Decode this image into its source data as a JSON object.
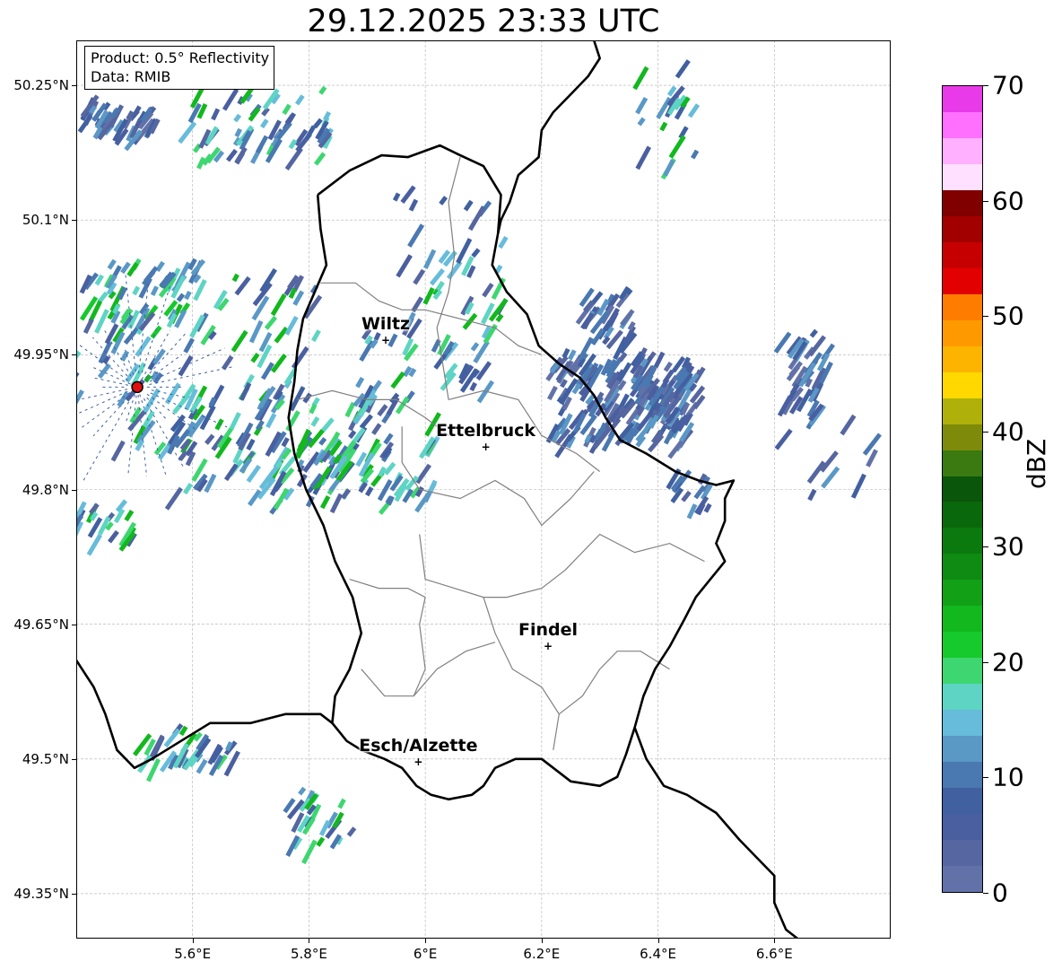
{
  "title": "29.12.2025 23:33 UTC",
  "info": {
    "product": "Product: 0.5° Reflectivity",
    "data": "Data: RMIB"
  },
  "map": {
    "lon_range": [
      5.4,
      6.8
    ],
    "lat_range": [
      49.3,
      50.3
    ],
    "lat_ticks": [
      {
        "value": 50.25,
        "label": "50.25°N"
      },
      {
        "value": 50.1,
        "label": "50.1°N"
      },
      {
        "value": 49.95,
        "label": "49.95°N"
      },
      {
        "value": 49.8,
        "label": "49.8°N"
      },
      {
        "value": 49.65,
        "label": "49.65°N"
      },
      {
        "value": 49.5,
        "label": "49.5°N"
      },
      {
        "value": 49.35,
        "label": "49.35°N"
      }
    ],
    "lon_ticks": [
      {
        "value": 5.6,
        "label": "5.6°E"
      },
      {
        "value": 5.8,
        "label": "5.8°E"
      },
      {
        "value": 6.0,
        "label": "6°E"
      },
      {
        "value": 6.2,
        "label": "6.2°E"
      },
      {
        "value": 6.4,
        "label": "6.4°E"
      },
      {
        "value": 6.6,
        "label": "6.6°E"
      }
    ],
    "radar_site": {
      "lon": 5.505,
      "lat": 49.914
    },
    "cities": [
      {
        "name": "Wiltz",
        "lon": 5.932,
        "lat": 49.966
      },
      {
        "name": "Ettelbruck",
        "lon": 6.104,
        "lat": 49.847
      },
      {
        "name": "Findel",
        "lon": 6.211,
        "lat": 49.626
      },
      {
        "name": "Esch/Alzette",
        "lon": 5.988,
        "lat": 49.497
      }
    ],
    "country_border": [
      [
        5.815,
        50.128
      ],
      [
        5.87,
        50.155
      ],
      [
        5.925,
        50.172
      ],
      [
        5.97,
        50.17
      ],
      [
        6.025,
        50.183
      ],
      [
        6.06,
        50.172
      ],
      [
        6.1,
        50.16
      ],
      [
        6.13,
        50.128
      ],
      [
        6.125,
        50.085
      ],
      [
        6.115,
        50.05
      ],
      [
        6.14,
        50.02
      ],
      [
        6.175,
        49.995
      ],
      [
        6.195,
        49.96
      ],
      [
        6.23,
        49.94
      ],
      [
        6.265,
        49.925
      ],
      [
        6.29,
        49.905
      ],
      [
        6.31,
        49.88
      ],
      [
        6.335,
        49.855
      ],
      [
        6.38,
        49.84
      ],
      [
        6.43,
        49.82
      ],
      [
        6.47,
        49.81
      ],
      [
        6.5,
        49.805
      ],
      [
        6.53,
        49.81
      ],
      [
        6.515,
        49.79
      ],
      [
        6.515,
        49.765
      ],
      [
        6.5,
        49.74
      ],
      [
        6.515,
        49.72
      ],
      [
        6.49,
        49.7
      ],
      [
        6.465,
        49.68
      ],
      [
        6.445,
        49.655
      ],
      [
        6.42,
        49.625
      ],
      [
        6.395,
        49.6
      ],
      [
        6.375,
        49.57
      ],
      [
        6.36,
        49.535
      ],
      [
        6.345,
        49.505
      ],
      [
        6.33,
        49.48
      ],
      [
        6.3,
        49.47
      ],
      [
        6.25,
        49.475
      ],
      [
        6.2,
        49.5
      ],
      [
        6.155,
        49.5
      ],
      [
        6.12,
        49.49
      ],
      [
        6.1,
        49.47
      ],
      [
        6.08,
        49.46
      ],
      [
        6.04,
        49.455
      ],
      [
        6.01,
        49.46
      ],
      [
        5.985,
        49.47
      ],
      [
        5.96,
        49.49
      ],
      [
        5.93,
        49.5
      ],
      [
        5.89,
        49.51
      ],
      [
        5.865,
        49.52
      ],
      [
        5.84,
        49.54
      ],
      [
        5.845,
        49.57
      ],
      [
        5.87,
        49.6
      ],
      [
        5.89,
        49.64
      ],
      [
        5.875,
        49.68
      ],
      [
        5.845,
        49.72
      ],
      [
        5.825,
        49.76
      ],
      [
        5.795,
        49.8
      ],
      [
        5.775,
        49.84
      ],
      [
        5.765,
        49.88
      ],
      [
        5.775,
        49.92
      ],
      [
        5.78,
        49.955
      ],
      [
        5.79,
        49.99
      ],
      [
        5.81,
        50.02
      ],
      [
        5.83,
        50.05
      ],
      [
        5.82,
        50.09
      ],
      [
        5.815,
        50.128
      ]
    ],
    "east_border": [
      [
        6.29,
        50.3
      ],
      [
        6.3,
        50.28
      ],
      [
        6.28,
        50.26
      ],
      [
        6.25,
        50.24
      ],
      [
        6.22,
        50.22
      ],
      [
        6.2,
        50.2
      ],
      [
        6.195,
        50.17
      ],
      [
        6.16,
        50.15
      ],
      [
        6.145,
        50.12
      ],
      [
        6.13,
        50.1
      ],
      [
        6.125,
        50.085
      ]
    ],
    "south_border": [
      [
        5.4,
        49.61
      ],
      [
        5.43,
        49.58
      ],
      [
        5.45,
        49.55
      ],
      [
        5.47,
        49.51
      ],
      [
        5.5,
        49.49
      ],
      [
        5.53,
        49.5
      ],
      [
        5.58,
        49.52
      ],
      [
        5.63,
        49.54
      ],
      [
        5.7,
        49.54
      ],
      [
        5.76,
        49.55
      ],
      [
        5.82,
        49.55
      ],
      [
        5.84,
        49.54
      ]
    ],
    "southeast_border": [
      [
        6.36,
        49.535
      ],
      [
        6.38,
        49.5
      ],
      [
        6.41,
        49.47
      ],
      [
        6.45,
        49.46
      ],
      [
        6.5,
        49.44
      ],
      [
        6.54,
        49.41
      ],
      [
        6.57,
        49.39
      ],
      [
        6.6,
        49.37
      ],
      [
        6.6,
        49.34
      ],
      [
        6.62,
        49.31
      ],
      [
        6.64,
        49.3
      ]
    ],
    "cantons": [
      [
        [
          5.82,
          50.03
        ],
        [
          5.88,
          50.03
        ],
        [
          5.92,
          50.01
        ],
        [
          5.96,
          50.0
        ],
        [
          6.0,
          50.0
        ],
        [
          6.06,
          49.99
        ],
        [
          6.12,
          49.98
        ],
        [
          6.16,
          49.96
        ],
        [
          6.2,
          49.95
        ]
      ],
      [
        [
          5.78,
          49.9
        ],
        [
          5.84,
          49.91
        ],
        [
          5.9,
          49.9
        ],
        [
          5.95,
          49.9
        ],
        [
          6.0,
          49.88
        ],
        [
          6.04,
          49.86
        ]
      ],
      [
        [
          6.06,
          50.17
        ],
        [
          6.04,
          50.12
        ],
        [
          6.05,
          50.06
        ],
        [
          6.04,
          50.02
        ],
        [
          6.02,
          49.98
        ],
        [
          6.03,
          49.94
        ],
        [
          6.04,
          49.9
        ]
      ],
      [
        [
          6.04,
          49.9
        ],
        [
          6.1,
          49.91
        ],
        [
          6.16,
          49.9
        ],
        [
          6.2,
          49.86
        ],
        [
          6.26,
          49.84
        ],
        [
          6.3,
          49.82
        ]
      ],
      [
        [
          5.96,
          49.87
        ],
        [
          5.96,
          49.83
        ],
        [
          5.99,
          49.8
        ],
        [
          6.06,
          49.79
        ],
        [
          6.12,
          49.81
        ],
        [
          6.17,
          49.79
        ],
        [
          6.2,
          49.76
        ],
        [
          6.25,
          49.79
        ],
        [
          6.29,
          49.82
        ]
      ],
      [
        [
          5.87,
          49.7
        ],
        [
          5.92,
          49.69
        ],
        [
          5.97,
          49.69
        ],
        [
          6.0,
          49.68
        ],
        [
          5.99,
          49.65
        ],
        [
          6.0,
          49.6
        ],
        [
          5.98,
          49.57
        ],
        [
          5.93,
          49.57
        ],
        [
          5.89,
          49.6
        ]
      ],
      [
        [
          5.99,
          49.75
        ],
        [
          6.0,
          49.7
        ],
        [
          6.05,
          49.69
        ],
        [
          6.1,
          49.68
        ],
        [
          6.14,
          49.68
        ],
        [
          6.2,
          49.69
        ],
        [
          6.24,
          49.71
        ],
        [
          6.3,
          49.75
        ],
        [
          6.36,
          49.73
        ],
        [
          6.42,
          49.74
        ],
        [
          6.48,
          49.72
        ]
      ],
      [
        [
          6.1,
          49.68
        ],
        [
          6.12,
          49.64
        ],
        [
          6.15,
          49.6
        ],
        [
          6.2,
          49.58
        ],
        [
          6.23,
          49.55
        ],
        [
          6.22,
          49.51
        ]
      ],
      [
        [
          5.98,
          49.57
        ],
        [
          6.02,
          49.6
        ],
        [
          6.07,
          49.62
        ],
        [
          6.12,
          49.63
        ]
      ],
      [
        [
          6.23,
          49.55
        ],
        [
          6.27,
          49.57
        ],
        [
          6.3,
          49.6
        ],
        [
          6.33,
          49.62
        ],
        [
          6.37,
          49.62
        ],
        [
          6.42,
          49.6
        ]
      ]
    ]
  },
  "colorbar": {
    "unit": "dBZ",
    "min": 0,
    "max": 70,
    "step": 2.5,
    "ticks": [
      {
        "value": 0,
        "label": "0"
      },
      {
        "value": 10,
        "label": "10"
      },
      {
        "value": 20,
        "label": "20"
      },
      {
        "value": 30,
        "label": "30"
      },
      {
        "value": 40,
        "label": "40"
      },
      {
        "value": 50,
        "label": "50"
      },
      {
        "value": 60,
        "label": "60"
      },
      {
        "value": 70,
        "label": "70"
      }
    ],
    "colors": [
      "#6272a8",
      "#5566a0",
      "#4a5fa0",
      "#4060a0",
      "#4a78b0",
      "#5a98c6",
      "#66bcda",
      "#5ed4c4",
      "#3ed670",
      "#16c92c",
      "#12b81e",
      "#12a016",
      "#0f8a12",
      "#0b7a0e",
      "#0a680c",
      "#0a560a",
      "#3a7a10",
      "#7e8a0a",
      "#b0b00a",
      "#ffd800",
      "#fdb400",
      "#fe9a00",
      "#fe7c00",
      "#e20000",
      "#c60000",
      "#a20000",
      "#800000",
      "#ffe0ff",
      "#ffb0ff",
      "#ff70ff",
      "#e83ae8"
    ]
  },
  "echoes": [
    {
      "lon": 5.48,
      "lat": 50.22,
      "w": 0.06,
      "h": 0.02,
      "n": 40,
      "pal": "blue"
    },
    {
      "lon": 5.72,
      "lat": 50.21,
      "w": 0.12,
      "h": 0.04,
      "n": 60,
      "pal": "mix"
    },
    {
      "lon": 5.53,
      "lat": 50.02,
      "w": 0.1,
      "h": 0.04,
      "n": 50,
      "pal": "green"
    },
    {
      "lon": 5.6,
      "lat": 49.95,
      "w": 0.22,
      "h": 0.1,
      "n": 110,
      "pal": "mix"
    },
    {
      "lon": 5.75,
      "lat": 49.86,
      "w": 0.18,
      "h": 0.06,
      "n": 80,
      "pal": "mix"
    },
    {
      "lon": 5.88,
      "lat": 49.83,
      "w": 0.14,
      "h": 0.04,
      "n": 70,
      "pal": "mix"
    },
    {
      "lon": 6.0,
      "lat": 49.93,
      "w": 0.12,
      "h": 0.05,
      "n": 40,
      "pal": "mix"
    },
    {
      "lon": 6.34,
      "lat": 49.91,
      "w": 0.12,
      "h": 0.05,
      "n": 160,
      "pal": "blue"
    },
    {
      "lon": 6.42,
      "lat": 49.91,
      "w": 0.06,
      "h": 0.03,
      "n": 50,
      "pal": "blue"
    },
    {
      "lon": 6.32,
      "lat": 50.0,
      "w": 0.04,
      "h": 0.03,
      "n": 30,
      "pal": "blue"
    },
    {
      "lon": 6.66,
      "lat": 49.94,
      "w": 0.04,
      "h": 0.04,
      "n": 35,
      "pal": "blue"
    },
    {
      "lon": 6.42,
      "lat": 50.22,
      "w": 0.05,
      "h": 0.06,
      "n": 20,
      "pal": "mix"
    },
    {
      "lon": 5.6,
      "lat": 49.52,
      "w": 0.08,
      "h": 0.02,
      "n": 30,
      "pal": "mix"
    },
    {
      "lon": 5.82,
      "lat": 49.44,
      "w": 0.06,
      "h": 0.03,
      "n": 25,
      "pal": "mix"
    },
    {
      "lon": 6.05,
      "lat": 50.06,
      "w": 0.1,
      "h": 0.08,
      "n": 40,
      "pal": "mix"
    },
    {
      "lon": 6.7,
      "lat": 49.85,
      "w": 0.08,
      "h": 0.05,
      "n": 12,
      "pal": "blue"
    },
    {
      "lon": 6.46,
      "lat": 49.8,
      "w": 0.03,
      "h": 0.03,
      "n": 15,
      "pal": "blue"
    },
    {
      "lon": 5.45,
      "lat": 49.77,
      "w": 0.05,
      "h": 0.02,
      "n": 20,
      "pal": "mix"
    }
  ]
}
